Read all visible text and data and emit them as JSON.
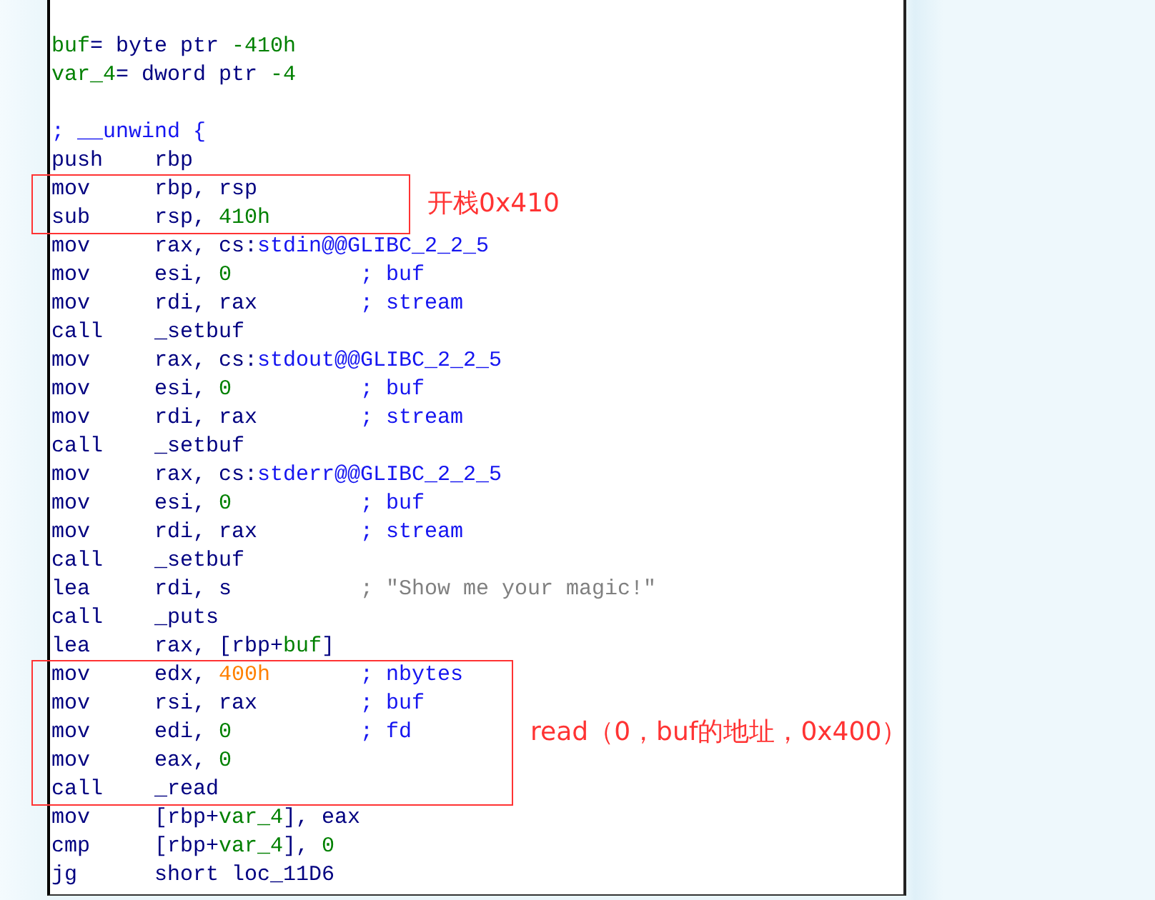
{
  "listing": [
    {
      "lines": [
        {
          "kind": "text",
          "parts": [
            {
              "text": "buf",
              "kind": "number"
            },
            {
              "text": "= byte ptr ",
              "kind": "plain"
            },
            {
              "text": "-410h",
              "kind": "number"
            }
          ]
        },
        {
          "kind": "text",
          "parts": [
            {
              "text": "var_4",
              "kind": "number"
            },
            {
              "text": "= dword ptr ",
              "kind": "plain"
            },
            {
              "text": "-4",
              "kind": "number"
            }
          ]
        },
        {
          "kind": "blank"
        },
        {
          "kind": "text",
          "parts": [
            {
              "text": "; __unwind {",
              "kind": "name"
            }
          ]
        },
        {
          "kind": "instr",
          "mnemonic": "push",
          "operands": [
            {
              "text": "rbp",
              "kind": "plain"
            }
          ]
        }
      ]
    },
    {
      "note": "开栈0x410",
      "lines": [
        {
          "kind": "instr",
          "mnemonic": "mov",
          "operands": [
            {
              "text": "rbp, rsp",
              "kind": "plain"
            }
          ]
        },
        {
          "kind": "instr",
          "mnemonic": "sub",
          "operands": [
            {
              "text": "rsp, ",
              "kind": "plain"
            },
            {
              "text": "410h",
              "kind": "number"
            }
          ]
        }
      ]
    },
    {
      "lines": [
        {
          "kind": "instr",
          "mnemonic": "mov",
          "operands": [
            {
              "text": "rax, cs:",
              "kind": "plain"
            },
            {
              "text": "stdin@@GLIBC_2_2_5",
              "kind": "name"
            }
          ]
        },
        {
          "kind": "instr",
          "mnemonic": "mov",
          "operands": [
            {
              "text": "esi, ",
              "kind": "plain"
            },
            {
              "text": "0",
              "kind": "number"
            }
          ],
          "comment": {
            "text": "; buf",
            "kind": "name"
          }
        },
        {
          "kind": "instr",
          "mnemonic": "mov",
          "operands": [
            {
              "text": "rdi, rax",
              "kind": "plain"
            }
          ],
          "comment": {
            "text": "; stream",
            "kind": "name"
          }
        },
        {
          "kind": "instr",
          "mnemonic": "call",
          "operands": [
            {
              "text": "_setbuf",
              "kind": "plain"
            }
          ]
        },
        {
          "kind": "instr",
          "mnemonic": "mov",
          "operands": [
            {
              "text": "rax, cs:",
              "kind": "plain"
            },
            {
              "text": "stdout@@GLIBC_2_2_5",
              "kind": "name"
            }
          ]
        },
        {
          "kind": "instr",
          "mnemonic": "mov",
          "operands": [
            {
              "text": "esi, ",
              "kind": "plain"
            },
            {
              "text": "0",
              "kind": "number"
            }
          ],
          "comment": {
            "text": "; buf",
            "kind": "name"
          }
        },
        {
          "kind": "instr",
          "mnemonic": "mov",
          "operands": [
            {
              "text": "rdi, rax",
              "kind": "plain"
            }
          ],
          "comment": {
            "text": "; stream",
            "kind": "name"
          }
        },
        {
          "kind": "instr",
          "mnemonic": "call",
          "operands": [
            {
              "text": "_setbuf",
              "kind": "plain"
            }
          ]
        },
        {
          "kind": "instr",
          "mnemonic": "mov",
          "operands": [
            {
              "text": "rax, cs:",
              "kind": "plain"
            },
            {
              "text": "stderr@@GLIBC_2_2_5",
              "kind": "name"
            }
          ]
        },
        {
          "kind": "instr",
          "mnemonic": "mov",
          "operands": [
            {
              "text": "esi, ",
              "kind": "plain"
            },
            {
              "text": "0",
              "kind": "number"
            }
          ],
          "comment": {
            "text": "; buf",
            "kind": "name"
          }
        },
        {
          "kind": "instr",
          "mnemonic": "mov",
          "operands": [
            {
              "text": "rdi, rax",
              "kind": "plain"
            }
          ],
          "comment": {
            "text": "; stream",
            "kind": "name"
          }
        },
        {
          "kind": "instr",
          "mnemonic": "call",
          "operands": [
            {
              "text": "_setbuf",
              "kind": "plain"
            }
          ]
        },
        {
          "kind": "instr",
          "mnemonic": "lea",
          "operands": [
            {
              "text": "rdi, s",
              "kind": "plain"
            }
          ],
          "comment": {
            "text": "; \"Show me your magic!\"",
            "kind": "string"
          }
        },
        {
          "kind": "instr",
          "mnemonic": "call",
          "operands": [
            {
              "text": "_puts",
              "kind": "plain"
            }
          ]
        },
        {
          "kind": "instr",
          "mnemonic": "lea",
          "operands": [
            {
              "text": "rax, [rbp+",
              "kind": "plain"
            },
            {
              "text": "buf",
              "kind": "number"
            },
            {
              "text": "]",
              "kind": "plain"
            }
          ]
        }
      ]
    },
    {
      "note": "read（0，buf的地址，0x400）",
      "lines": [
        {
          "kind": "instr",
          "mnemonic": "mov",
          "operands": [
            {
              "text": "edx, ",
              "kind": "plain"
            },
            {
              "text": "400h",
              "kind": "const"
            }
          ],
          "comment": {
            "text": "; nbytes",
            "kind": "name"
          }
        },
        {
          "kind": "instr",
          "mnemonic": "mov",
          "operands": [
            {
              "text": "rsi, rax",
              "kind": "plain"
            }
          ],
          "comment": {
            "text": "; buf",
            "kind": "name"
          }
        },
        {
          "kind": "instr",
          "mnemonic": "mov",
          "operands": [
            {
              "text": "edi, ",
              "kind": "plain"
            },
            {
              "text": "0",
              "kind": "number"
            }
          ],
          "comment": {
            "text": "; fd",
            "kind": "name"
          }
        },
        {
          "kind": "instr",
          "mnemonic": "mov",
          "operands": [
            {
              "text": "eax, ",
              "kind": "plain"
            },
            {
              "text": "0",
              "kind": "number"
            }
          ]
        },
        {
          "kind": "instr",
          "mnemonic": "call",
          "operands": [
            {
              "text": "_read",
              "kind": "plain"
            }
          ]
        }
      ]
    },
    {
      "lines": [
        {
          "kind": "instr",
          "mnemonic": "mov",
          "operands": [
            {
              "text": "[rbp+",
              "kind": "plain"
            },
            {
              "text": "var_4",
              "kind": "number"
            },
            {
              "text": "], eax",
              "kind": "plain"
            }
          ]
        },
        {
          "kind": "instr",
          "mnemonic": "cmp",
          "operands": [
            {
              "text": "[rbp+",
              "kind": "plain"
            },
            {
              "text": "var_4",
              "kind": "number"
            },
            {
              "text": "], ",
              "kind": "plain"
            },
            {
              "text": "0",
              "kind": "number"
            }
          ]
        },
        {
          "kind": "instr",
          "mnemonic": "jg",
          "operands": [
            {
              "text": "short loc_11D6",
              "kind": "plain"
            }
          ]
        }
      ]
    }
  ]
}
